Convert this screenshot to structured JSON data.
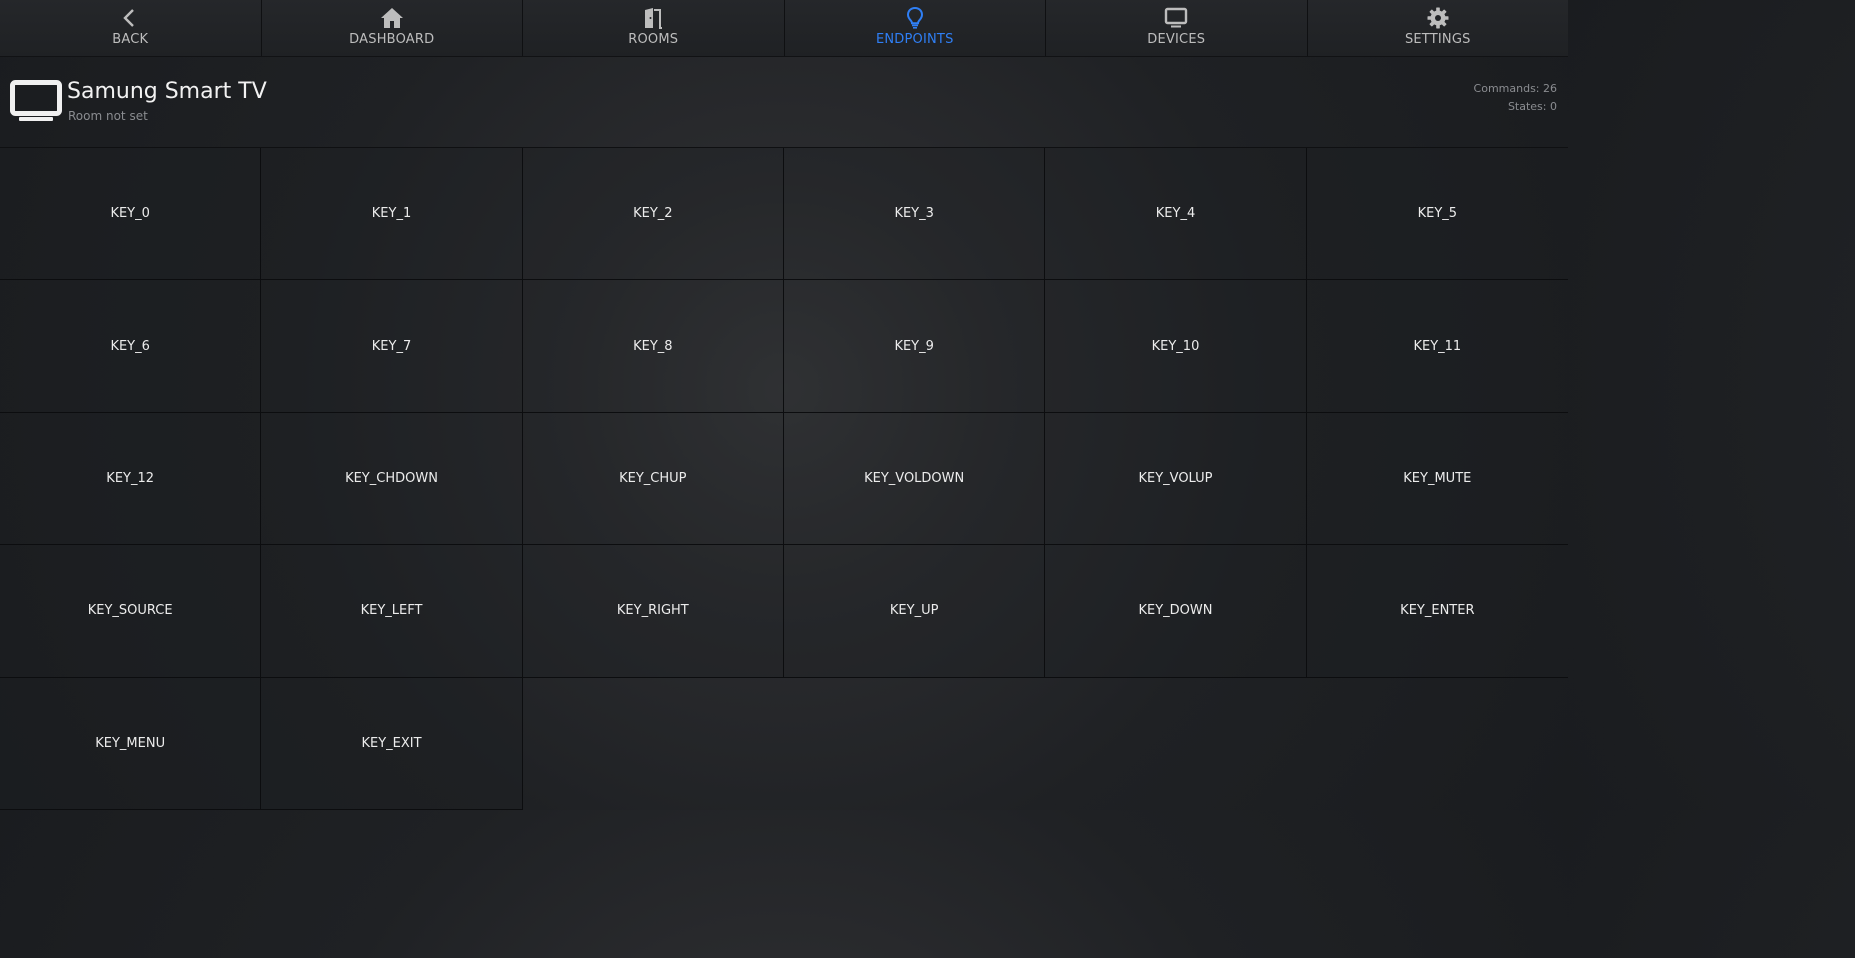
{
  "nav": {
    "items": [
      {
        "label": "BACK",
        "icon": "chevron-left-icon"
      },
      {
        "label": "DASHBOARD",
        "icon": "home-icon"
      },
      {
        "label": "ROOMS",
        "icon": "door-icon"
      },
      {
        "label": "ENDPOINTS",
        "icon": "lightbulb-icon",
        "active": true
      },
      {
        "label": "DEVICES",
        "icon": "monitor-icon"
      },
      {
        "label": "SETTINGS",
        "icon": "gear-icon"
      }
    ],
    "active_color": "#2f7ff5"
  },
  "device": {
    "icon": "tv-icon",
    "title": "Samung Smart TV",
    "subtitle": "Room not set",
    "commands": "Commands: 26",
    "states": "States: 0"
  },
  "commands": [
    "KEY_0",
    "KEY_1",
    "KEY_2",
    "KEY_3",
    "KEY_4",
    "KEY_5",
    "KEY_6",
    "KEY_7",
    "KEY_8",
    "KEY_9",
    "KEY_10",
    "KEY_11",
    "KEY_12",
    "KEY_CHDOWN",
    "KEY_CHUP",
    "KEY_VOLDOWN",
    "KEY_VOLUP",
    "KEY_MUTE",
    "KEY_SOURCE",
    "KEY_LEFT",
    "KEY_RIGHT",
    "KEY_UP",
    "KEY_DOWN",
    "KEY_ENTER",
    "KEY_MENU",
    "KEY_EXIT"
  ]
}
